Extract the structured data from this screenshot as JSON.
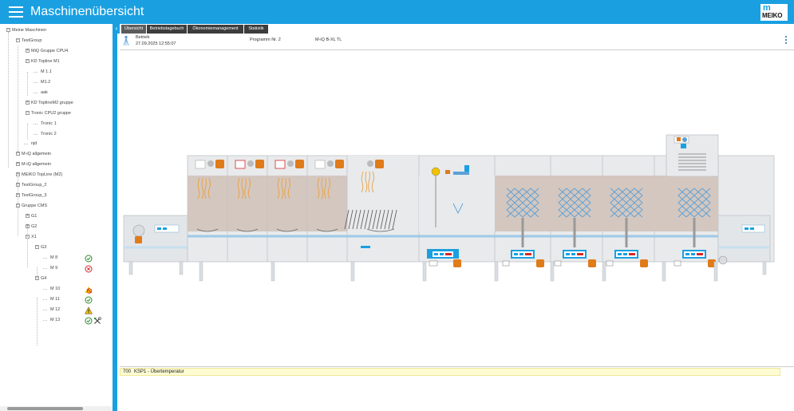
{
  "header": {
    "title": "Maschinenübersicht",
    "logo_letter": "m",
    "logo_text": "MEIKO"
  },
  "tabs": [
    {
      "label": "Übersicht",
      "active": true
    },
    {
      "label": "Betriebstagebuch",
      "active": false
    },
    {
      "label": "Ökonomiemanagement",
      "active": false
    },
    {
      "label": "Statistik",
      "active": false
    }
  ],
  "info": {
    "status": "Betrieb",
    "datetime": "27.09.2025 12:55:07",
    "program": "Programm Nr. 2",
    "model": "M-iQ B-XL TL"
  },
  "message": {
    "code": "700",
    "text": "KSP1 - Übertemperatur"
  },
  "tree": [
    {
      "label": "Meine Maschinen",
      "level": 0,
      "expander": "-"
    },
    {
      "label": "TestGroup",
      "level": 1,
      "expander": "-"
    },
    {
      "label": "MiQ Gruppe CPU4",
      "level": 2,
      "expander": "+"
    },
    {
      "label": "KD Topline M1",
      "level": 2,
      "expander": "-"
    },
    {
      "label": "M 1.1",
      "level": 3,
      "expander": ""
    },
    {
      "label": "M1.2",
      "level": 3,
      "expander": ""
    },
    {
      "label": "aak",
      "level": 3,
      "expander": ""
    },
    {
      "label": "KD ToplineM2 gruppe",
      "level": 2,
      "expander": "+"
    },
    {
      "label": "Tronic CPU2 gruppe",
      "level": 2,
      "expander": "-"
    },
    {
      "label": "Tronic 1",
      "level": 3,
      "expander": ""
    },
    {
      "label": "Tronic 2",
      "level": 3,
      "expander": ""
    },
    {
      "label": "njd",
      "level": 2,
      "expander": ""
    },
    {
      "label": "M-iQ allgemein",
      "level": 1,
      "expander": "+"
    },
    {
      "label": "M-iQ allgemein",
      "level": 1,
      "expander": "+"
    },
    {
      "label": "MEIKO TopLine (M2)",
      "level": 1,
      "expander": "+"
    },
    {
      "label": "TestGroup_2",
      "level": 1,
      "expander": "+"
    },
    {
      "label": "TestGroup_3",
      "level": 1,
      "expander": "+"
    },
    {
      "label": "Gruppe CMS",
      "level": 1,
      "expander": "-"
    },
    {
      "label": "G1",
      "level": 2,
      "expander": "+"
    },
    {
      "label": "G2",
      "level": 2,
      "expander": "+"
    },
    {
      "label": "X1",
      "level": 2,
      "expander": "-"
    },
    {
      "label": "G3",
      "level": 3,
      "expander": "-"
    },
    {
      "label": "M 8",
      "level": 4,
      "expander": "",
      "status": [
        "ok"
      ]
    },
    {
      "label": "M 9",
      "level": 4,
      "expander": "",
      "status": [
        "error"
      ]
    },
    {
      "label": "G4",
      "level": 3,
      "expander": "-"
    },
    {
      "label": "M 10",
      "level": 4,
      "expander": "",
      "status": [
        "offline"
      ]
    },
    {
      "label": "M 11",
      "level": 4,
      "expander": "",
      "status": [
        "ok"
      ]
    },
    {
      "label": "M 12",
      "level": 4,
      "expander": "",
      "status": [
        "warning"
      ]
    },
    {
      "label": "M 13",
      "level": 4,
      "expander": "",
      "status": [
        "ok",
        "service"
      ]
    }
  ],
  "colors": {
    "accent": "#1aa0e1",
    "tab_bg": "#3d3d3d",
    "message_bg": "#fdfbd2",
    "status_ok": "#2e8b2e",
    "status_error": "#d62828",
    "status_warning": "#f2c200",
    "machine_orange": "#e07b1a",
    "spray": "#e8a040",
    "rinse_blue": "#5aa0d8"
  },
  "icons": {
    "menu": "hamburger-icon",
    "more": "more-vertical-icon",
    "status_machine": "spray-status-icon",
    "ok": "check-circle-icon",
    "error": "x-circle-icon",
    "warning": "warning-icon",
    "offline": "offline-icon",
    "service": "service-tools-icon"
  }
}
